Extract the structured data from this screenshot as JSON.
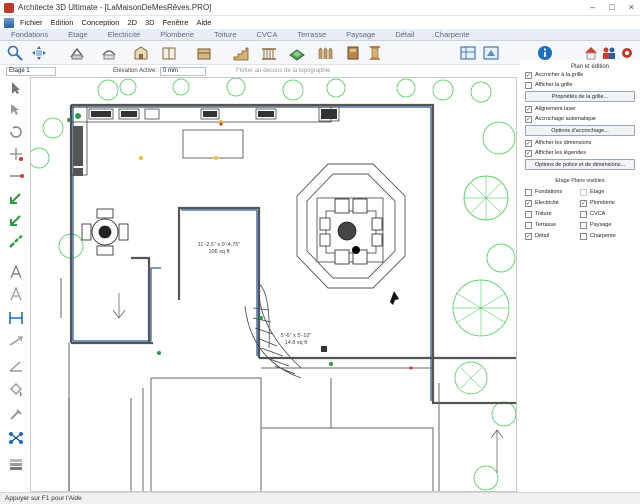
{
  "window": {
    "title": "Architecte 3D Ultimate - [LaMaisonDeMesRêves.PRO]",
    "controls": [
      "–",
      "□",
      "×"
    ]
  },
  "menu": [
    "Fichier",
    "Edition",
    "Conception",
    "2D",
    "3D",
    "Fenêtre",
    "Aide"
  ],
  "tabs": [
    "Fondations",
    "Etage",
    "Electricité",
    "Plomberie",
    "Toiture",
    "CVCA",
    "Terrasse",
    "Paysage",
    "Détail",
    "Charpente"
  ],
  "toolbar2": {
    "floor_value": "Etage 1",
    "elevation_label": "Élévation Active:",
    "elevation_value": "0 mm",
    "terrain_label": "Flotter au-dessus de la topographie"
  },
  "canvas": {
    "room1_dims": "11'-2.5\" x 9'-4.75\"",
    "room1_area": "106 sq ft",
    "room2_dims": "5'-6\" x 5'-10\"",
    "room2_area": "14.8 sq ft"
  },
  "panel": {
    "title": "Plan et édition",
    "options": [
      {
        "label": "Accrocher à la grille",
        "checked": true
      },
      {
        "label": "Afficher la grille",
        "checked": false
      }
    ],
    "grid_props_button": "Propriétés de la grille...",
    "options2": [
      {
        "label": "Alignement laser",
        "checked": true
      },
      {
        "label": "Accrochage automatique",
        "checked": true
      }
    ],
    "snap_options_button": "Options d'accrochage...",
    "options3": [
      {
        "label": "Afficher les dimensions",
        "checked": true
      },
      {
        "label": "Afficher les légendes",
        "checked": true
      }
    ],
    "font_options_button": "Options de police et de dimensions...",
    "visible_section": "Etage Plans visibles",
    "layers": [
      {
        "label": "Fondations",
        "checked": false
      },
      {
        "label": "Etage",
        "checked": false
      },
      {
        "label": "Electricité",
        "checked": true
      },
      {
        "label": "Plomberie",
        "checked": true
      },
      {
        "label": "Toiture",
        "checked": false
      },
      {
        "label": "CVCA",
        "checked": false
      },
      {
        "label": "Terrasse",
        "checked": false
      },
      {
        "label": "Paysage",
        "checked": false
      },
      {
        "label": "Détail",
        "checked": true
      },
      {
        "label": "Charpente",
        "checked": false
      }
    ]
  },
  "status": "Appuyer sur F1 pour l'Aide",
  "colors": {
    "wall": "#555555",
    "tabtext": "#5a6b85",
    "plant": "#2ecc40",
    "accent": "#1a6fc4"
  }
}
